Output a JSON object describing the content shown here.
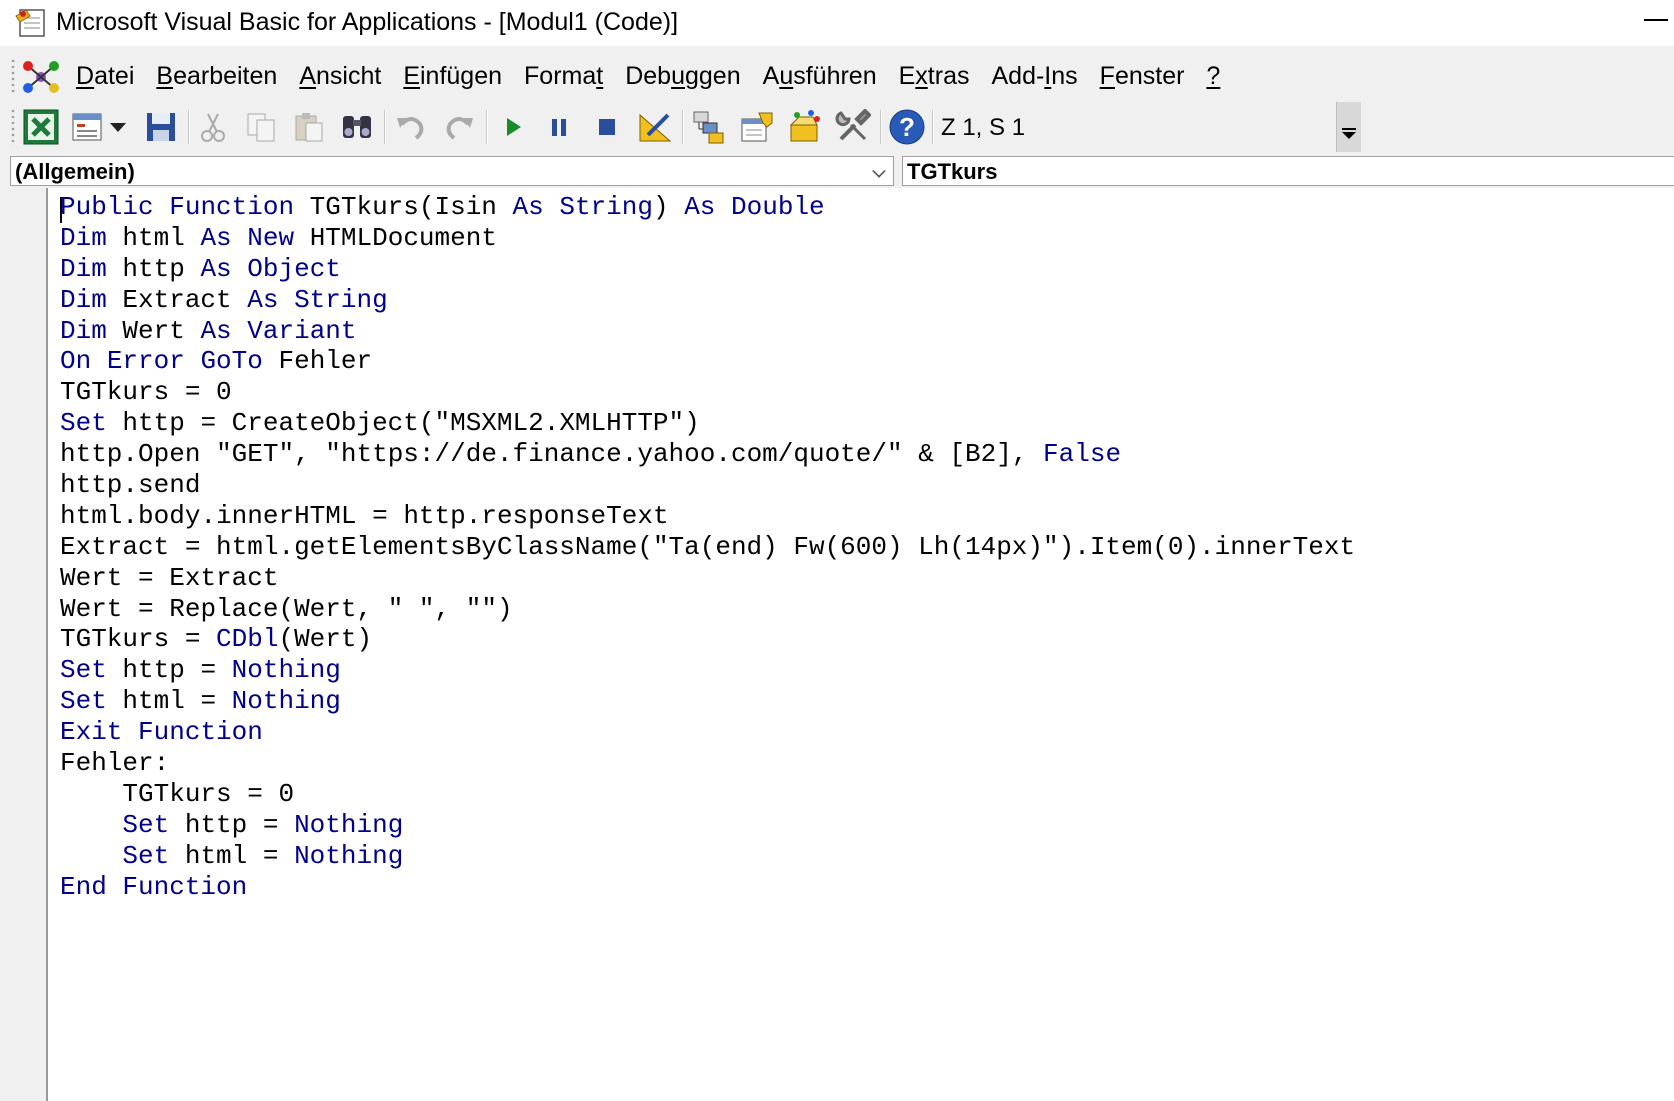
{
  "window": {
    "title": "Microsoft Visual Basic for Applications - [Modul1 (Code)]"
  },
  "menu": {
    "items": [
      {
        "label": "Datei",
        "accel": 0
      },
      {
        "label": "Bearbeiten",
        "accel": 0
      },
      {
        "label": "Ansicht",
        "accel": 0
      },
      {
        "label": "Einfügen",
        "accel": 0
      },
      {
        "label": "Format",
        "accel": 5
      },
      {
        "label": "Debuggen",
        "accel": 3
      },
      {
        "label": "Ausführen",
        "accel": 1
      },
      {
        "label": "Extras",
        "accel": 1
      },
      {
        "label": "Add-Ins",
        "accel": 4
      },
      {
        "label": "Fenster",
        "accel": 0
      },
      {
        "label": "?",
        "accel": 0
      }
    ]
  },
  "toolbar": {
    "icons": [
      "excel-view-icon",
      "insert-userform-icon",
      "dropdown-arrow-icon",
      "save-icon",
      "cut-icon",
      "copy-icon",
      "paste-icon",
      "find-icon",
      "undo-icon",
      "redo-icon",
      "run-icon",
      "break-icon",
      "reset-icon",
      "design-mode-icon",
      "project-explorer-icon",
      "properties-window-icon",
      "object-browser-icon",
      "toolbox-icon",
      "help-icon"
    ],
    "position": "Z 1, S 1"
  },
  "combos": {
    "object": "(Allgemein)",
    "procedure": "TGTkurs"
  },
  "colors": {
    "keyword": "#00008b",
    "text": "#000000"
  },
  "code": [
    "Public Function TGTkurs(Isin As String) As Double",
    "Dim html As New HTMLDocument",
    "Dim http As Object",
    "Dim Extract As String",
    "Dim Wert As Variant",
    "On Error GoTo Fehler",
    "TGTkurs = 0",
    "Set http = CreateObject(\"MSXML2.XMLHTTP\")",
    "http.Open \"GET\", \"https://de.finance.yahoo.com/quote/\" & [B2], False",
    "http.send",
    "html.body.innerHTML = http.responseText",
    "Extract = html.getElementsByClassName(\"Ta(end) Fw(600) Lh(14px)\").Item(0).innerText",
    "Wert = Extract",
    "Wert = Replace(Wert, \" \", \"\")",
    "TGTkurs = CDbl(Wert)",
    "Set http = Nothing",
    "Set html = Nothing",
    "Exit Function",
    "Fehler:",
    "    TGTkurs = 0",
    "    Set http = Nothing",
    "    Set html = Nothing",
    "End Function"
  ],
  "keywords": [
    "Public",
    "Function",
    "As",
    "String",
    "Double",
    "Dim",
    "New",
    "Object",
    "Variant",
    "On",
    "Error",
    "GoTo",
    "Set",
    "False",
    "CDbl",
    "Nothing",
    "Exit",
    "End"
  ]
}
